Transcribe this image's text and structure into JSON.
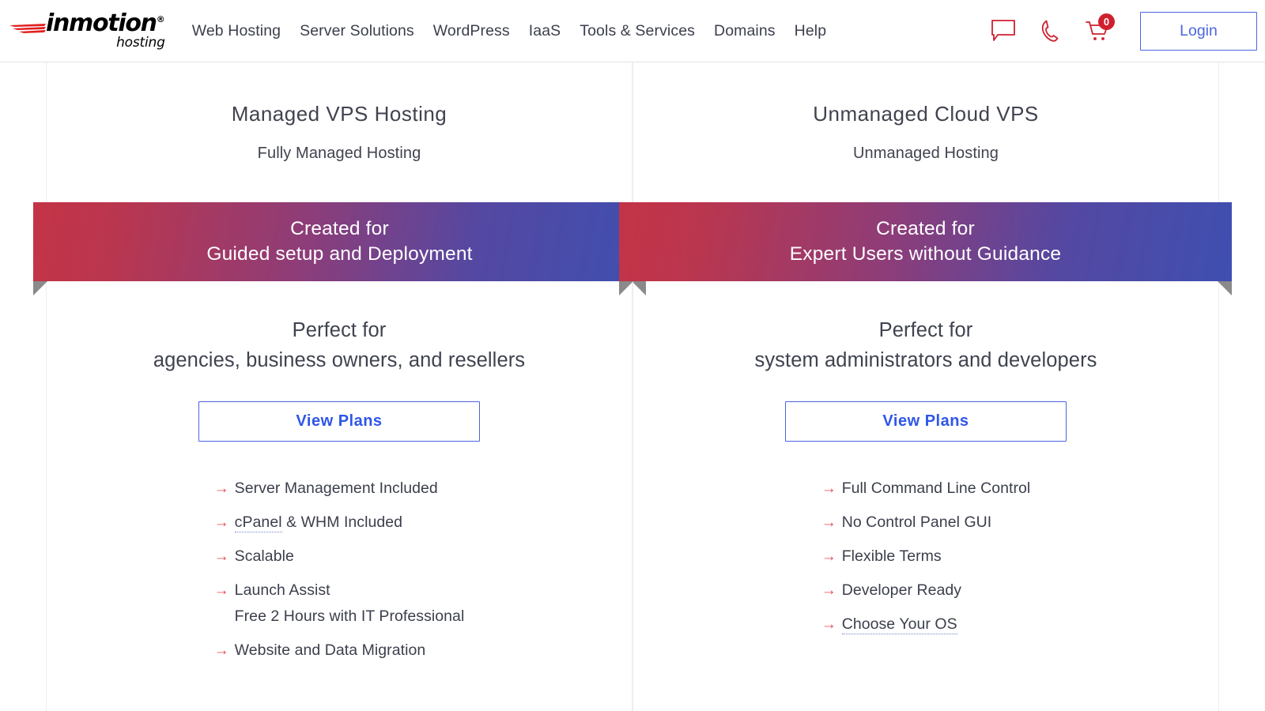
{
  "header": {
    "brand": {
      "name": "inmotion",
      "registered": "®",
      "tagline": "hosting",
      "swoosh_icon": "swoosh-icon"
    },
    "nav_items": [
      {
        "label": "Web Hosting"
      },
      {
        "label": "Server Solutions"
      },
      {
        "label": "WordPress"
      },
      {
        "label": "IaaS"
      },
      {
        "label": "Tools & Services"
      },
      {
        "label": "Domains"
      },
      {
        "label": "Help"
      }
    ],
    "icons": [
      {
        "name": "chat-icon"
      },
      {
        "name": "phone-icon"
      },
      {
        "name": "cart-icon",
        "badge": "0"
      }
    ],
    "login_label": "Login",
    "accent_red": "#cf2030",
    "accent_blue": "#4a66df"
  },
  "plans": [
    {
      "title": "Managed VPS Hosting",
      "subtitle": "Fully Managed Hosting",
      "ribbon": {
        "line1": "Created for",
        "line2": "Guided setup and Deployment",
        "gradient_from": "#c43346",
        "gradient_to": "#3f4fb0"
      },
      "perfect_line1": "Perfect for",
      "perfect_line2": "agencies, business owners, and resellers",
      "cta_label": "View Plans",
      "features": [
        {
          "text": "Server Management Included"
        },
        {
          "text_before": "",
          "tooltip": "cPanel",
          "text_after": " & WHM Included"
        },
        {
          "text": "Scalable"
        },
        {
          "text": "Launch Assist",
          "sub": "Free 2 Hours with IT Professional"
        },
        {
          "text": "Website and Data Migration"
        }
      ]
    },
    {
      "title": "Unmanaged Cloud VPS",
      "subtitle": "Unmanaged Hosting",
      "ribbon": {
        "line1": "Created for",
        "line2": "Expert Users without Guidance",
        "gradient_from": "#c43346",
        "gradient_to": "#3f4fb0"
      },
      "perfect_line1": "Perfect for",
      "perfect_line2": "system administrators and developers",
      "cta_label": "View Plans",
      "features": [
        {
          "text": "Full Command Line Control"
        },
        {
          "text": "No Control Panel GUI"
        },
        {
          "text": "Flexible Terms"
        },
        {
          "text": "Developer Ready"
        },
        {
          "text_before": "",
          "tooltip": "Choose Your OS",
          "text_after": ""
        }
      ]
    }
  ],
  "arrow_glyph": "→"
}
